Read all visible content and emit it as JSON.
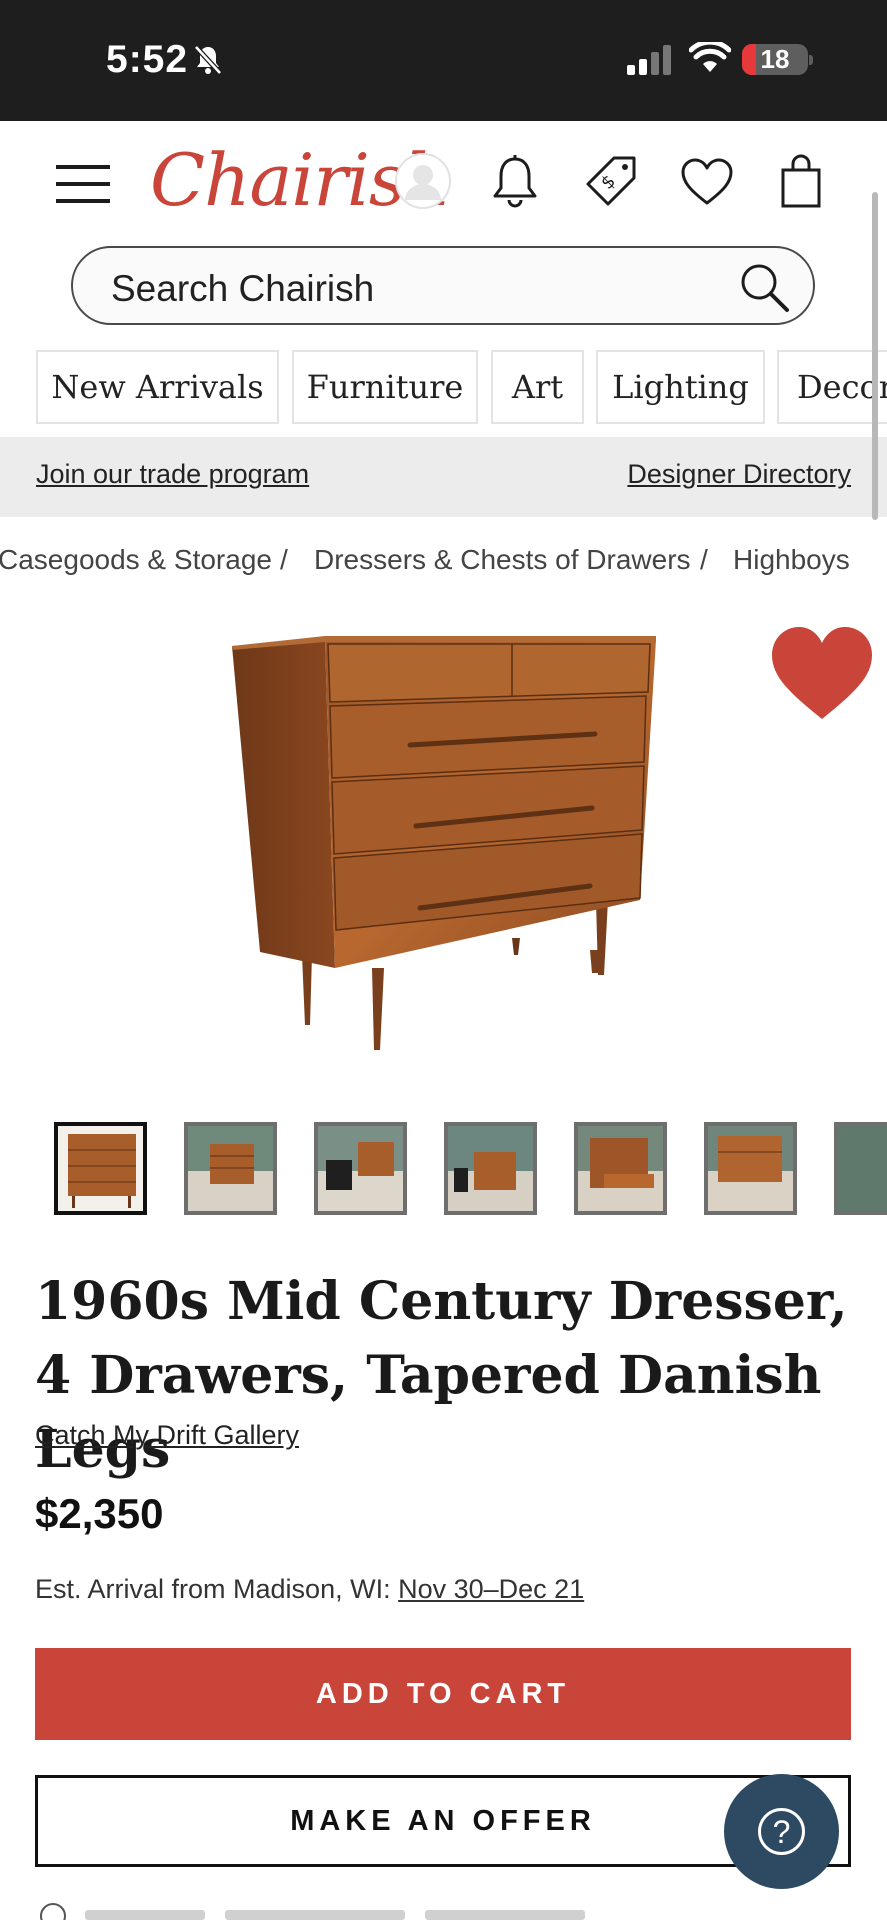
{
  "status_bar": {
    "time": "5:52",
    "battery": "18",
    "icons": [
      "bell-slash-icon",
      "signal-icon",
      "wifi-icon",
      "battery-icon"
    ]
  },
  "header": {
    "logo": "Chairish",
    "icons": [
      "menu-icon",
      "avatar",
      "bell-icon",
      "tag-icon",
      "heart-icon",
      "bag-icon"
    ]
  },
  "search": {
    "placeholder": "Search Chairish"
  },
  "categories": [
    "New Arrivals",
    "Furniture",
    "Art",
    "Lighting",
    "Decor"
  ],
  "trade_bar": {
    "left_link": "Join our trade program",
    "right_link": "Designer Directory"
  },
  "breadcrumb": [
    "Casegoods & Storage",
    "Dressers & Chests of Drawers",
    "Highboys"
  ],
  "breadcrumb_separator": "/",
  "product": {
    "title": "1960s Mid Century Dresser, 4 Drawers, Tapered Danish Legs",
    "seller": "Catch My Drift Gallery",
    "price": "$2,350",
    "arrival_label": "Est. Arrival from Madison, WI:",
    "arrival_date": "Nov 30–Dec 21",
    "favorited": true,
    "thumbnail_count": 7,
    "selected_thumbnail": 1
  },
  "buttons": {
    "add_to_cart": "ADD TO CART",
    "make_offer": "MAKE AN OFFER",
    "help": "?"
  },
  "colors": {
    "brand": "#c9453a",
    "help": "#2e4a62",
    "status_bar": "#1e1e1e"
  }
}
